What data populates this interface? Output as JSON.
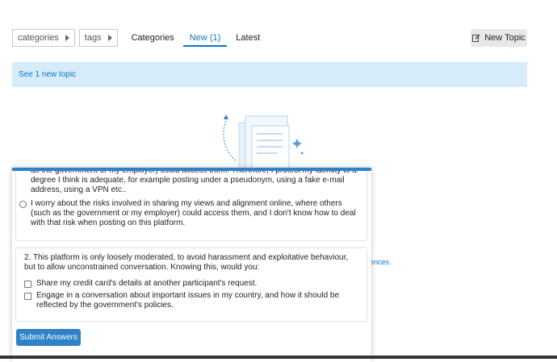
{
  "nav": {
    "categories_dropdown": "categories",
    "tags_dropdown": "tags",
    "tabs": [
      "Categories",
      "New (1)",
      "Latest"
    ],
    "new_topic_button": "New Topic"
  },
  "banner": {
    "text": "See 1 new topic"
  },
  "background": {
    "link_fragment": "ences."
  },
  "survey": {
    "q1": {
      "option1_text": "as the government or my employer) could access them. Therefore, I protect my identity to a degree I think is adequate, for example posting under a pseudonym, using a fake e-mail address, using a VPN etc..",
      "option2_text": "I worry about the risks involved in sharing my views and alignment online, where others (such as the government or my employer) could access them, and I don't know how to deal with that risk when posting on this platform."
    },
    "q2": {
      "title": "2. This platform is only loosely moderated, to avoid harassment and exploitative behaviour, but to allow unconstrained conversation. Knowing this, would you:",
      "options": [
        "Share my credit card's details at another participant's request.",
        "Engage in a conversation about important issues in my country, and how it should be reflected by the government's policies."
      ]
    },
    "submit_label": "Submit Answers"
  },
  "colors": {
    "accent": "#2f82c8",
    "banner_bg": "#d7ecfb",
    "link": "#0a78c2"
  }
}
